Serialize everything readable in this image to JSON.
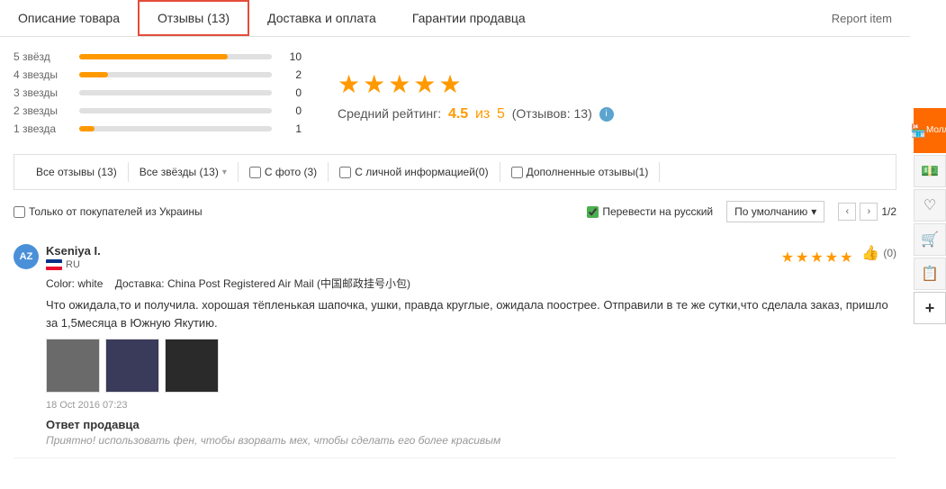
{
  "tabs": [
    {
      "id": "description",
      "label": "Описание товара",
      "active": false
    },
    {
      "id": "reviews",
      "label": "Отзывы (13)",
      "active": true
    },
    {
      "id": "delivery",
      "label": "Доставка и оплата",
      "active": false
    },
    {
      "id": "seller",
      "label": "Гарантии продавца",
      "active": false
    }
  ],
  "report": {
    "label": "Report item"
  },
  "rating": {
    "stars": [
      {
        "label": "5 звёзд",
        "count": 10,
        "pct": 77
      },
      {
        "label": "4 звезды",
        "count": 2,
        "pct": 15
      },
      {
        "label": "3 звезды",
        "count": 0,
        "pct": 0
      },
      {
        "label": "2 звезды",
        "count": 0,
        "pct": 0
      },
      {
        "label": "1 звезда",
        "count": 1,
        "pct": 8
      }
    ],
    "avg": "4.5",
    "out_of": "5",
    "review_count": "13",
    "avg_label": "Средний рейтинг:",
    "out_of_text": "из",
    "reviews_text": "Отзывов:"
  },
  "filters": {
    "all_reviews": "Все отзывы (13)",
    "all_stars": "Все звёзды (13)",
    "with_photo": "С фото (3)",
    "with_info": "С личной информацией(0)",
    "additional": "Дополненные отзывы(1)"
  },
  "options": {
    "ukraine_only": "Только от покупателей из Украины",
    "translate": "Перевести на русский",
    "sort_label": "По умолчанию",
    "page": "1/2"
  },
  "reviews": [
    {
      "id": 1,
      "avatar_initials": "AZ",
      "name": "Kseniya I.",
      "country": "RU",
      "stars": 5,
      "color_label": "Color:",
      "color_value": "white",
      "delivery_label": "Доставка:",
      "delivery_value": "China Post Registered Air Mail (中国邮政挂号小包)",
      "text": "Что ожидала,то и получила. хорошая тёпленькая шапочка, ушки, правда круглые, ожидала поострее. Отправили в те же сутки,что сделала заказ, пришло за 1,5месяца в Южную Якутию.",
      "images": 3,
      "date": "18 Oct 2016 07:23",
      "like_count": "(0)",
      "seller_reply_title": "Ответ продавца",
      "seller_reply_text": "Приятно! использовать фен, чтобы взорвать мех, чтобы сделать его более красивым"
    }
  ],
  "sidebar": {
    "mall_label": "Молл",
    "icons": [
      "💰",
      "♥",
      "🛒",
      "📋"
    ]
  }
}
